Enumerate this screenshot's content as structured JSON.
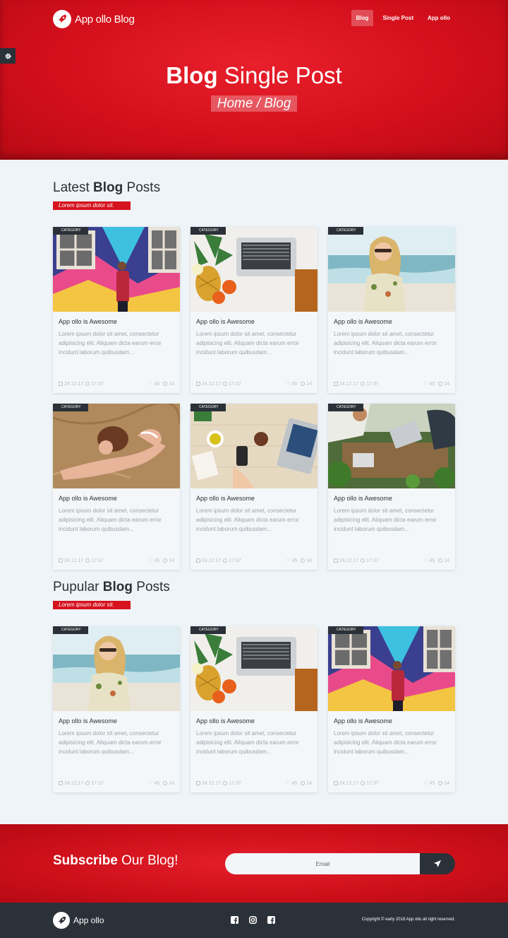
{
  "brand": {
    "name": "App ollo Blog"
  },
  "nav": {
    "items": [
      "Blog",
      "Single Post",
      "App ollo"
    ]
  },
  "hero": {
    "title_bold": "Blog",
    "title_rest": " Single Post",
    "breadcrumb": "Home / Blog"
  },
  "latest": {
    "title_pre": "Latest ",
    "title_bold": "Blog",
    "title_post": " Posts",
    "subtitle": "Lorem ipsum dolor sit."
  },
  "popular": {
    "title_pre": "Pupular ",
    "title_bold": "Blog",
    "title_post": " Posts",
    "subtitle": "Lorem ipsum dolor sit."
  },
  "card": {
    "category": "CATEGORY",
    "title": "App ollo is Awesome",
    "excerpt": "Lorem ipsum dolor sit amet, consectetur adipisicing elit. Aliquam dicta earum error incidunt laborum quibusdam...",
    "date": "24.12.17",
    "time": "17:37",
    "likes": "45",
    "comments": "14"
  },
  "subscribe": {
    "title_bold": "Subscribe",
    "title_rest": " Our Blog!",
    "email_placeholder": "Email"
  },
  "footer": {
    "brand": "App ollo",
    "copyright": "Copyright © early 2018 App ollo all right reserved."
  }
}
